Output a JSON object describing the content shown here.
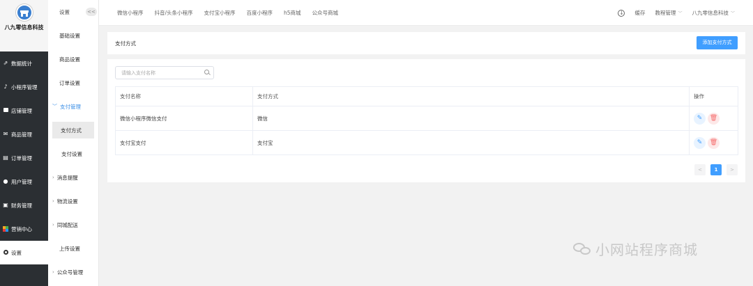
{
  "brand": {
    "name": "八九零信息科技"
  },
  "nav": [
    {
      "label": "数据统计",
      "icon": "chart-icon"
    },
    {
      "label": "小程序管理",
      "icon": "link-icon"
    },
    {
      "label": "店铺管理",
      "icon": "store-icon"
    },
    {
      "label": "商品管理",
      "icon": "mail-icon"
    },
    {
      "label": "订单管理",
      "icon": "order-icon"
    },
    {
      "label": "用户管理",
      "icon": "user-icon"
    },
    {
      "label": "财务管理",
      "icon": "finance-icon"
    },
    {
      "label": "营销中心",
      "icon": "marketing-icon"
    },
    {
      "label": "设置",
      "icon": "settings-ring-icon",
      "active": true
    }
  ],
  "subnav": {
    "header": "设置",
    "collapse": "<<",
    "items": [
      {
        "label": "基础设置"
      },
      {
        "label": "商品设置"
      },
      {
        "label": "订单设置"
      },
      {
        "label": "支付管理",
        "expanded": true
      },
      {
        "label": "支付方式",
        "selected": true
      },
      {
        "label": "支付设置"
      },
      {
        "label": "消息提醒"
      },
      {
        "label": "物流设置"
      },
      {
        "label": "同城配送"
      },
      {
        "label": "上传设置"
      },
      {
        "label": "公众号管理"
      }
    ]
  },
  "topbar": {
    "tabs": [
      "微信小程序",
      "抖音/头条小程序",
      "支付宝小程序",
      "百度小程序",
      "h5商城",
      "公众号商城"
    ],
    "cache": "缓存",
    "tutorial": "教程管理",
    "account": "八九零信息科技"
  },
  "page": {
    "title": "支付方式",
    "add_button": "添加支付方式",
    "search_placeholder": "请输入支付名称"
  },
  "table": {
    "columns": [
      "支付名称",
      "支付方式",
      "操作"
    ],
    "rows": [
      {
        "name": "微信小程序微信支付",
        "method": "微信"
      },
      {
        "name": "支付宝支付",
        "method": "支付宝"
      }
    ]
  },
  "pagination": {
    "prev": "<",
    "current": "1",
    "next": ">"
  },
  "watermark": {
    "text": "小网站程序商城"
  },
  "colors": {
    "primary": "#409eff",
    "danger": "#f56c6c",
    "sidebar": "#2b2f33"
  }
}
